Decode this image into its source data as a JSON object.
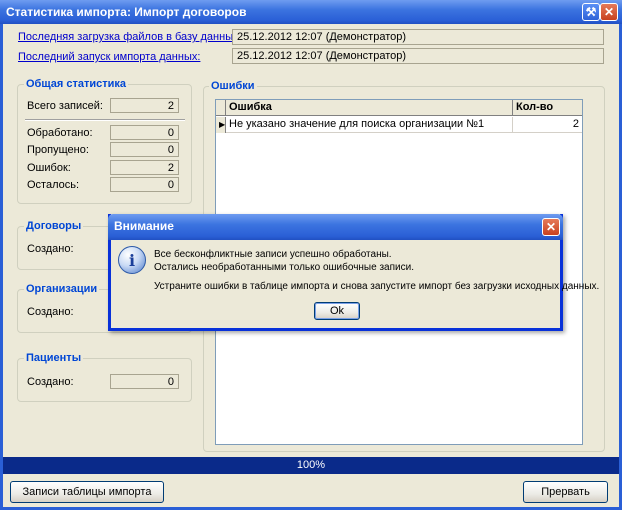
{
  "window": {
    "title": "Статистика импорта: Импорт договоров",
    "tools_icon": "wrench-icon",
    "close_icon": "close-icon"
  },
  "header": {
    "last_upload_label": "Последняя загрузка файлов в базу данных:",
    "last_upload_value": "25.12.2012 12:07 (Демонстратор)",
    "last_run_label": "Последний запуск импорта данных:",
    "last_run_value": "25.12.2012 12:07 (Демонстратор)"
  },
  "general": {
    "title": "Общая статистика",
    "total_label": "Всего записей:",
    "total_value": "2",
    "processed_label": "Обработано:",
    "processed_value": "0",
    "skipped_label": "Пропущено:",
    "skipped_value": "0",
    "errors_label": "Ошибок:",
    "errors_value": "2",
    "remaining_label": "Осталось:",
    "remaining_value": "0"
  },
  "contracts": {
    "title": "Договоры",
    "created_label": "Создано:"
  },
  "organizations": {
    "title": "Организации",
    "created_label": "Создано:"
  },
  "patients": {
    "title": "Пациенты",
    "created_label": "Создано:",
    "created_value": "0"
  },
  "errors_panel": {
    "title": "Ошибки",
    "columns": [
      "Ошибка",
      "Кол-во"
    ],
    "rows": [
      {
        "error": "Не указано значение для поиска организации №1",
        "count": "2"
      }
    ]
  },
  "progress": {
    "value": 100,
    "label": "100%"
  },
  "buttons": {
    "import_records": "Записи таблицы импорта",
    "abort": "Прервать"
  },
  "dialog": {
    "title": "Внимание",
    "icon": "info-icon",
    "line1": "Все бесконфликтные записи успешно обработаны.",
    "line2": "Остались необработанными только ошибочные записи.",
    "line3": "Устраните ошибки в таблице импорта и снова запустите импорт без загрузки исходных данных.",
    "ok": "Ok"
  },
  "colors": {
    "titlebar": "#2a5fd6",
    "group_title": "#0046d5",
    "progress": "#0a2a8a"
  }
}
